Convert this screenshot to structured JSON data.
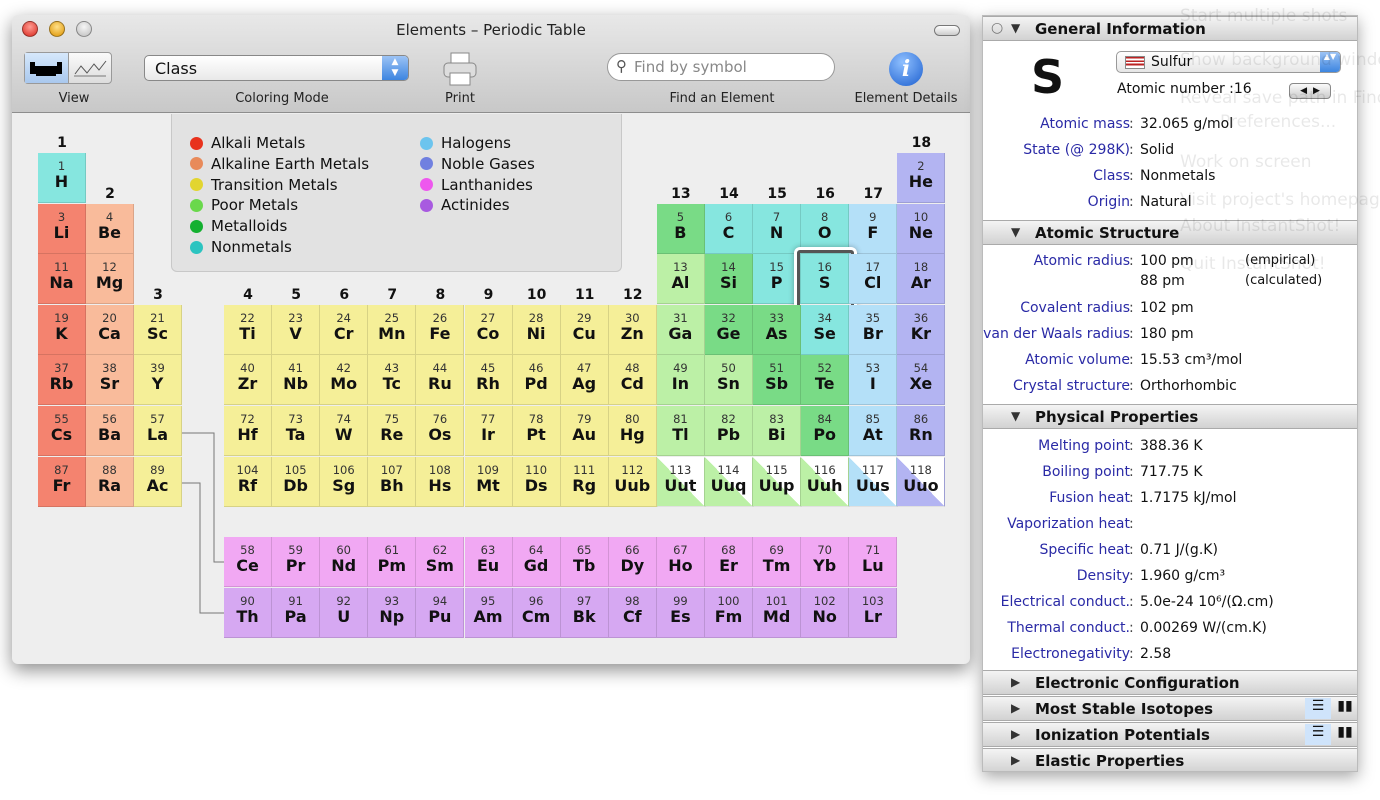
{
  "window": {
    "title": "Elements – Periodic Table"
  },
  "toolbar": {
    "view_label": "View",
    "coloring_label": "Coloring Mode",
    "coloring_value": "Class",
    "print_label": "Print",
    "find_label": "Find an Element",
    "find_placeholder": "Find by symbol",
    "details_label": "Element Details"
  },
  "legend": [
    {
      "name": "Alkali Metals",
      "key": "alk",
      "color": "#f4836f"
    },
    {
      "name": "Alkaline Earth Metals",
      "key": "ae",
      "color": "#f9bb9b"
    },
    {
      "name": "Transition Metals",
      "key": "tm",
      "color": "#f5ef98"
    },
    {
      "name": "Poor Metals",
      "key": "pm",
      "color": "#bcf0a6"
    },
    {
      "name": "Metalloids",
      "key": "md",
      "color": "#79db86"
    },
    {
      "name": "Nonmetals",
      "key": "nm",
      "color": "#86e6df"
    },
    {
      "name": "Halogens",
      "key": "ha",
      "color": "#b4e0f8"
    },
    {
      "name": "Noble Gases",
      "key": "ng",
      "color": "#b3b4f2"
    },
    {
      "name": "Lanthanides",
      "key": "la",
      "color": "#f1a8f3"
    },
    {
      "name": "Actinides",
      "key": "ac",
      "color": "#d6a8f2"
    }
  ],
  "legend_dot_colors": {
    "alk": "#e8321c",
    "ae": "#e88a5a",
    "tm": "#e2d530",
    "pm": "#6ad84c",
    "md": "#14b030",
    "nm": "#2cc4c0",
    "ha": "#6cc4ee",
    "ng": "#7080e0",
    "la": "#ee58ee",
    "ac": "#a85ae0"
  },
  "group_labels": [
    "1",
    "2",
    "3",
    "4",
    "5",
    "6",
    "7",
    "8",
    "9",
    "10",
    "11",
    "12",
    "13",
    "14",
    "15",
    "16",
    "17",
    "18"
  ],
  "selected_element": 16,
  "elements": [
    [
      1,
      "H",
      "nm",
      1,
      1
    ],
    [
      2,
      "He",
      "ng",
      18,
      1
    ],
    [
      3,
      "Li",
      "alk",
      1,
      2
    ],
    [
      4,
      "Be",
      "ae",
      2,
      2
    ],
    [
      5,
      "B",
      "md",
      13,
      2
    ],
    [
      6,
      "C",
      "nm",
      14,
      2
    ],
    [
      7,
      "N",
      "nm",
      15,
      2
    ],
    [
      8,
      "O",
      "nm",
      16,
      2
    ],
    [
      9,
      "F",
      "ha",
      17,
      2
    ],
    [
      10,
      "Ne",
      "ng",
      18,
      2
    ],
    [
      11,
      "Na",
      "alk",
      1,
      3
    ],
    [
      12,
      "Mg",
      "ae",
      2,
      3
    ],
    [
      13,
      "Al",
      "pm",
      13,
      3
    ],
    [
      14,
      "Si",
      "md",
      14,
      3
    ],
    [
      15,
      "P",
      "nm",
      15,
      3
    ],
    [
      16,
      "S",
      "nm",
      16,
      3
    ],
    [
      17,
      "Cl",
      "ha",
      17,
      3
    ],
    [
      18,
      "Ar",
      "ng",
      18,
      3
    ],
    [
      19,
      "K",
      "alk",
      1,
      4
    ],
    [
      20,
      "Ca",
      "ae",
      2,
      4
    ],
    [
      21,
      "Sc",
      "tm",
      3,
      4
    ],
    [
      22,
      "Ti",
      "tm",
      4,
      4
    ],
    [
      23,
      "V",
      "tm",
      5,
      4
    ],
    [
      24,
      "Cr",
      "tm",
      6,
      4
    ],
    [
      25,
      "Mn",
      "tm",
      7,
      4
    ],
    [
      26,
      "Fe",
      "tm",
      8,
      4
    ],
    [
      27,
      "Co",
      "tm",
      9,
      4
    ],
    [
      28,
      "Ni",
      "tm",
      10,
      4
    ],
    [
      29,
      "Cu",
      "tm",
      11,
      4
    ],
    [
      30,
      "Zn",
      "tm",
      12,
      4
    ],
    [
      31,
      "Ga",
      "pm",
      13,
      4
    ],
    [
      32,
      "Ge",
      "md",
      14,
      4
    ],
    [
      33,
      "As",
      "md",
      15,
      4
    ],
    [
      34,
      "Se",
      "nm",
      16,
      4
    ],
    [
      35,
      "Br",
      "ha",
      17,
      4
    ],
    [
      36,
      "Kr",
      "ng",
      18,
      4
    ],
    [
      37,
      "Rb",
      "alk",
      1,
      5
    ],
    [
      38,
      "Sr",
      "ae",
      2,
      5
    ],
    [
      39,
      "Y",
      "tm",
      3,
      5
    ],
    [
      40,
      "Zr",
      "tm",
      4,
      5
    ],
    [
      41,
      "Nb",
      "tm",
      5,
      5
    ],
    [
      42,
      "Mo",
      "tm",
      6,
      5
    ],
    [
      43,
      "Tc",
      "tm",
      7,
      5
    ],
    [
      44,
      "Ru",
      "tm",
      8,
      5
    ],
    [
      45,
      "Rh",
      "tm",
      9,
      5
    ],
    [
      46,
      "Pd",
      "tm",
      10,
      5
    ],
    [
      47,
      "Ag",
      "tm",
      11,
      5
    ],
    [
      48,
      "Cd",
      "tm",
      12,
      5
    ],
    [
      49,
      "In",
      "pm",
      13,
      5
    ],
    [
      50,
      "Sn",
      "pm",
      14,
      5
    ],
    [
      51,
      "Sb",
      "md",
      15,
      5
    ],
    [
      52,
      "Te",
      "md",
      16,
      5
    ],
    [
      53,
      "I",
      "ha",
      17,
      5
    ],
    [
      54,
      "Xe",
      "ng",
      18,
      5
    ],
    [
      55,
      "Cs",
      "alk",
      1,
      6
    ],
    [
      56,
      "Ba",
      "ae",
      2,
      6
    ],
    [
      57,
      "La",
      "tm",
      3,
      6
    ],
    [
      72,
      "Hf",
      "tm",
      4,
      6
    ],
    [
      73,
      "Ta",
      "tm",
      5,
      6
    ],
    [
      74,
      "W",
      "tm",
      6,
      6
    ],
    [
      75,
      "Re",
      "tm",
      7,
      6
    ],
    [
      76,
      "Os",
      "tm",
      8,
      6
    ],
    [
      77,
      "Ir",
      "tm",
      9,
      6
    ],
    [
      78,
      "Pt",
      "tm",
      10,
      6
    ],
    [
      79,
      "Au",
      "tm",
      11,
      6
    ],
    [
      80,
      "Hg",
      "tm",
      12,
      6
    ],
    [
      81,
      "Tl",
      "pm",
      13,
      6
    ],
    [
      82,
      "Pb",
      "pm",
      14,
      6
    ],
    [
      83,
      "Bi",
      "pm",
      15,
      6
    ],
    [
      84,
      "Po",
      "md",
      16,
      6
    ],
    [
      85,
      "At",
      "ha",
      17,
      6
    ],
    [
      86,
      "Rn",
      "ng",
      18,
      6
    ],
    [
      87,
      "Fr",
      "alk",
      1,
      7
    ],
    [
      88,
      "Ra",
      "ae",
      2,
      7
    ],
    [
      89,
      "Ac",
      "tm",
      3,
      7
    ],
    [
      104,
      "Rf",
      "tm",
      4,
      7
    ],
    [
      105,
      "Db",
      "tm",
      5,
      7
    ],
    [
      106,
      "Sg",
      "tm",
      6,
      7
    ],
    [
      107,
      "Bh",
      "tm",
      7,
      7
    ],
    [
      108,
      "Hs",
      "tm",
      8,
      7
    ],
    [
      109,
      "Mt",
      "tm",
      9,
      7
    ],
    [
      110,
      "Ds",
      "tm",
      10,
      7
    ],
    [
      111,
      "Rg",
      "tm",
      11,
      7
    ],
    [
      112,
      "Uub",
      "tm",
      12,
      7
    ],
    [
      113,
      "Uut",
      "pm*",
      13,
      7
    ],
    [
      114,
      "Uuq",
      "pm*",
      14,
      7
    ],
    [
      115,
      "Uup",
      "pm*",
      15,
      7
    ],
    [
      116,
      "Uuh",
      "pm*",
      16,
      7
    ],
    [
      117,
      "Uus",
      "ha*",
      17,
      7
    ],
    [
      118,
      "Uuo",
      "ng*",
      18,
      7
    ],
    [
      58,
      "Ce",
      "la",
      4,
      9
    ],
    [
      59,
      "Pr",
      "la",
      5,
      9
    ],
    [
      60,
      "Nd",
      "la",
      6,
      9
    ],
    [
      61,
      "Pm",
      "la",
      7,
      9
    ],
    [
      62,
      "Sm",
      "la",
      8,
      9
    ],
    [
      63,
      "Eu",
      "la",
      9,
      9
    ],
    [
      64,
      "Gd",
      "la",
      10,
      9
    ],
    [
      65,
      "Tb",
      "la",
      11,
      9
    ],
    [
      66,
      "Dy",
      "la",
      12,
      9
    ],
    [
      67,
      "Ho",
      "la",
      13,
      9
    ],
    [
      68,
      "Er",
      "la",
      14,
      9
    ],
    [
      69,
      "Tm",
      "la",
      15,
      9
    ],
    [
      70,
      "Yb",
      "la",
      16,
      9
    ],
    [
      71,
      "Lu",
      "la",
      17,
      9
    ],
    [
      90,
      "Th",
      "ac",
      4,
      10
    ],
    [
      91,
      "Pa",
      "ac",
      5,
      10
    ],
    [
      92,
      "U",
      "ac",
      6,
      10
    ],
    [
      93,
      "Np",
      "ac",
      7,
      10
    ],
    [
      94,
      "Pu",
      "ac",
      8,
      10
    ],
    [
      95,
      "Am",
      "ac",
      9,
      10
    ],
    [
      96,
      "Cm",
      "ac",
      10,
      10
    ],
    [
      97,
      "Bk",
      "ac",
      11,
      10
    ],
    [
      98,
      "Cf",
      "ac",
      12,
      10
    ],
    [
      99,
      "Es",
      "ac",
      13,
      10
    ],
    [
      100,
      "Fm",
      "ac",
      14,
      10
    ],
    [
      101,
      "Md",
      "ac",
      15,
      10
    ],
    [
      102,
      "No",
      "ac",
      16,
      10
    ],
    [
      103,
      "Lr",
      "ac",
      17,
      10
    ]
  ],
  "panel": {
    "general": {
      "title": "General Information",
      "symbol": "S",
      "name": "Sulfur",
      "atomic_number": "Atomic number :16",
      "rows": [
        [
          "Atomic mass",
          "32.065 g/mol"
        ],
        [
          "State (@ 298K)",
          "Solid"
        ],
        [
          "Class",
          "Nonmetals"
        ],
        [
          "Origin",
          "Natural"
        ]
      ]
    },
    "atomic": {
      "title": "Atomic Structure",
      "rows": [
        [
          "Atomic radius",
          "100 pm",
          "(empirical)"
        ],
        [
          "",
          "88 pm",
          "(calculated)"
        ],
        [
          "Covalent radius",
          "102 pm"
        ],
        [
          "van der Waals radius",
          "180 pm"
        ],
        [
          "Atomic volume",
          "15.53 cm³/mol"
        ],
        [
          "Crystal structure",
          "Orthorhombic"
        ]
      ]
    },
    "physical": {
      "title": "Physical Properties",
      "rows": [
        [
          "Melting point",
          "388.36 K"
        ],
        [
          "Boiling point",
          "717.75 K"
        ],
        [
          "Fusion heat",
          "1.7175 kJ/mol"
        ],
        [
          "Vaporization heat",
          ""
        ],
        [
          "Specific heat",
          "0.71 J/(g.K)"
        ],
        [
          "Density",
          "1.960 g/cm³"
        ],
        [
          "Electrical conduct.",
          "5.0e-24 10⁶/(Ω.cm)"
        ],
        [
          "Thermal conduct.",
          "0.00269 W/(cm.K)"
        ],
        [
          "Electronegativity",
          "2.58"
        ]
      ]
    },
    "collapsed": [
      "Electronic Configuration",
      "Most Stable Isotopes",
      "Ionization Potentials",
      "Elastic Properties"
    ]
  },
  "background_overlay_menu": [
    "Start multiple shots",
    "Show background window",
    "Reveal save path in Finder",
    "Preferences...",
    "Work on screen",
    "Visit project's homepage",
    "About InstantShot!",
    "Quit InstantShot!"
  ]
}
